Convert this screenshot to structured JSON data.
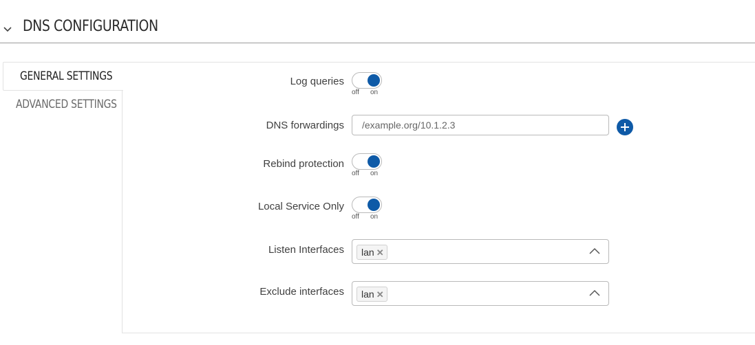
{
  "section": {
    "title": "DNS CONFIGURATION"
  },
  "tabs": [
    {
      "label": "GENERAL SETTINGS"
    },
    {
      "label": "ADVANCED SETTINGS"
    }
  ],
  "fields": {
    "log_queries": {
      "label": "Log queries",
      "off": "off",
      "on": "on",
      "state": "on"
    },
    "dns_forwardings": {
      "label": "DNS forwardings",
      "placeholder": "/example.org/10.1.2.3",
      "value": ""
    },
    "rebind_protection": {
      "label": "Rebind protection",
      "off": "off",
      "on": "on",
      "state": "on"
    },
    "local_service_only": {
      "label": "Local Service Only",
      "off": "off",
      "on": "on",
      "state": "on"
    },
    "listen_interfaces": {
      "label": "Listen Interfaces",
      "tags": [
        "lan"
      ]
    },
    "exclude_interfaces": {
      "label": "Exclude interfaces",
      "tags": [
        "lan"
      ]
    }
  },
  "colors": {
    "accent": "#0e5aa7",
    "border": "#b9b9b9",
    "divider": "#9a9a9a"
  },
  "icons": {
    "collapse": "chevron-down-icon",
    "add": "plus-circle-icon",
    "remove_tag": "close-icon",
    "dropdown": "chevron-up-icon"
  }
}
